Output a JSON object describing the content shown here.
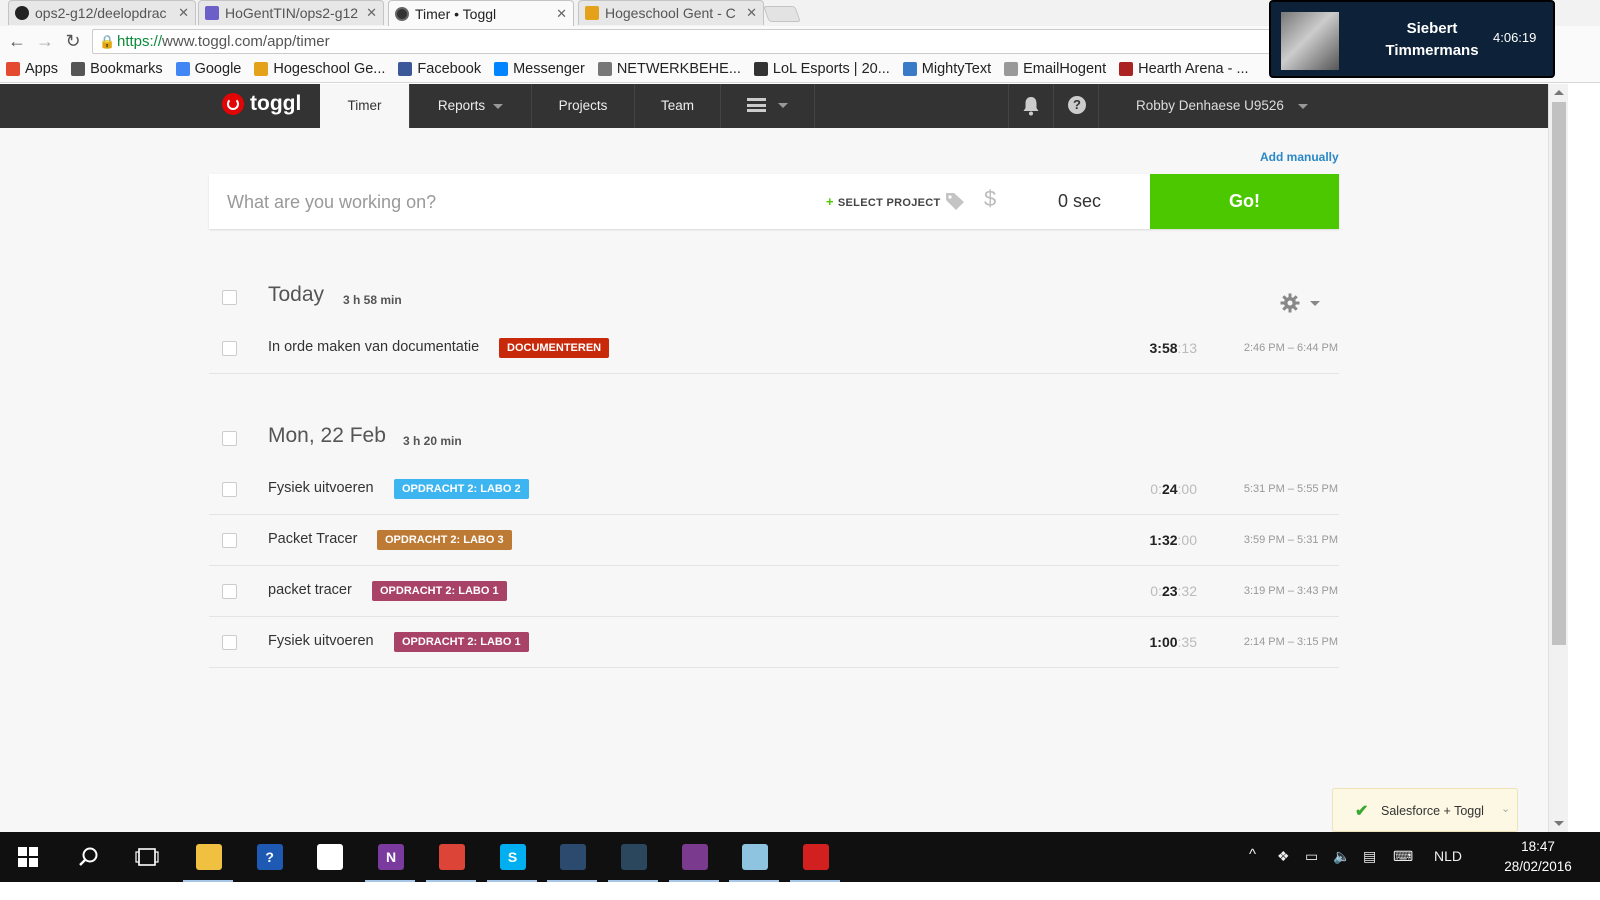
{
  "browser": {
    "tabs": [
      {
        "label": "ops2-g12/deelopdrac",
        "icon": "github-icon",
        "active": false
      },
      {
        "label": "HoGentTIN/ops2-g12",
        "icon": "heroku-icon",
        "active": false
      },
      {
        "label": "Timer • Toggl",
        "icon": "toggl-icon",
        "active": true
      },
      {
        "label": "Hogeschool Gent - C",
        "icon": "hogent-icon",
        "active": false
      }
    ],
    "url_scheme": "https://",
    "url_rest": "www.toggl.com/app/timer",
    "bookmarks": [
      {
        "label": "Apps",
        "icon": "apps-grid-icon",
        "color": "#e34a2f"
      },
      {
        "label": "Bookmarks",
        "icon": "star-icon",
        "color": "#555555"
      },
      {
        "label": "Google",
        "icon": "google-icon",
        "color": "#4285f4"
      },
      {
        "label": "Hogeschool Ge...",
        "icon": "hogent-icon",
        "color": "#e3a21a"
      },
      {
        "label": "Facebook",
        "icon": "facebook-icon",
        "color": "#3b5998"
      },
      {
        "label": "Messenger",
        "icon": "messenger-icon",
        "color": "#0084ff"
      },
      {
        "label": "NETWERKBEHE...",
        "icon": "network-icon",
        "color": "#777777"
      },
      {
        "label": "LoL Esports | 20...",
        "icon": "lol-icon",
        "color": "#333333"
      },
      {
        "label": "MightyText",
        "icon": "mightytext-icon",
        "color": "#3a7bc8"
      },
      {
        "label": "EmailHogent",
        "icon": "page-icon",
        "color": "#999999"
      },
      {
        "label": "Hearth Arena - ...",
        "icon": "hearth-arena-icon",
        "color": "#aa2222"
      }
    ]
  },
  "notification": {
    "name": "Siebert Timmermans",
    "time": "4:06:19"
  },
  "header": {
    "logo": "toggl",
    "nav": [
      {
        "label": "Timer",
        "active": true,
        "dropdown": false
      },
      {
        "label": "Reports",
        "active": false,
        "dropdown": true
      },
      {
        "label": "Projects",
        "active": false,
        "dropdown": false
      },
      {
        "label": "Team",
        "active": false,
        "dropdown": false
      }
    ],
    "user": "Robby Denhaese U9526"
  },
  "timer": {
    "add_manually": "Add manually",
    "placeholder": "What are you working on?",
    "select_project": "SELECT PROJECT",
    "duration": "0 sec",
    "go": "Go!"
  },
  "groups": [
    {
      "title": "Today",
      "total": "3 h 58 min",
      "entries": [
        {
          "description": "In orde maken van documentatie",
          "tag": "DOCUMENTEREN",
          "tag_color": "#c8290a",
          "dur_a": "",
          "dur_b": "3:58",
          "dur_c": ":13",
          "range": "2:46 PM – 6:44 PM"
        }
      ]
    },
    {
      "title": "Mon, 22 Feb",
      "total": "3 h 20 min",
      "entries": [
        {
          "description": "Fysiek uitvoeren",
          "tag": "OPDRACHT 2: LABO 2",
          "tag_color": "#3db5f0",
          "dur_a": "0:",
          "dur_b": "24",
          "dur_c": ":00",
          "range": "5:31 PM – 5:55 PM"
        },
        {
          "description": "Packet Tracer",
          "tag": "OPDRACHT 2: LABO 3",
          "tag_color": "#bd7a35",
          "dur_a": "",
          "dur_b": "1:32",
          "dur_c": ":00",
          "range": "3:59 PM – 5:31 PM"
        },
        {
          "description": "packet tracer",
          "tag": "OPDRACHT 2: LABO 1",
          "tag_color": "#a84266",
          "dur_a": "0:",
          "dur_b": "23",
          "dur_c": ":32",
          "range": "3:19 PM – 3:43 PM"
        },
        {
          "description": "Fysiek uitvoeren",
          "tag": "OPDRACHT 2: LABO 1",
          "tag_color": "#a84266",
          "dur_a": "",
          "dur_b": "1:00",
          "dur_c": ":35",
          "range": "2:14 PM – 3:15 PM"
        }
      ]
    }
  ],
  "toast": {
    "label": "Salesforce + Toggl"
  },
  "taskbar": {
    "apps": [
      {
        "name": "file-explorer-icon",
        "glyph": "",
        "color": "#f0c040",
        "running": true
      },
      {
        "name": "help-app-icon",
        "glyph": "?",
        "color": "#1e5ab4",
        "running": false
      },
      {
        "name": "store-grid-icon",
        "glyph": "",
        "color": "#ffffff",
        "running": false
      },
      {
        "name": "onenote-icon",
        "glyph": "N",
        "color": "#7b3b9e",
        "running": true
      },
      {
        "name": "chrome-icon",
        "glyph": "",
        "color": "#db4437",
        "running": true
      },
      {
        "name": "skype-icon",
        "glyph": "S",
        "color": "#00aff0",
        "running": true
      },
      {
        "name": "tree-app-icon",
        "glyph": "",
        "color": "#2c4a6e",
        "running": true
      },
      {
        "name": "steam-icon",
        "glyph": "",
        "color": "#2a475e",
        "running": true
      },
      {
        "name": "winrar-icon",
        "glyph": "",
        "color": "#7a3b8f",
        "running": true
      },
      {
        "name": "notes-app-icon",
        "glyph": "",
        "color": "#8fc4e0",
        "running": true
      },
      {
        "name": "acrobat-icon",
        "glyph": "",
        "color": "#d21f1f",
        "running": true
      }
    ],
    "language": "NLD",
    "time": "18:47",
    "date": "28/02/2016"
  }
}
